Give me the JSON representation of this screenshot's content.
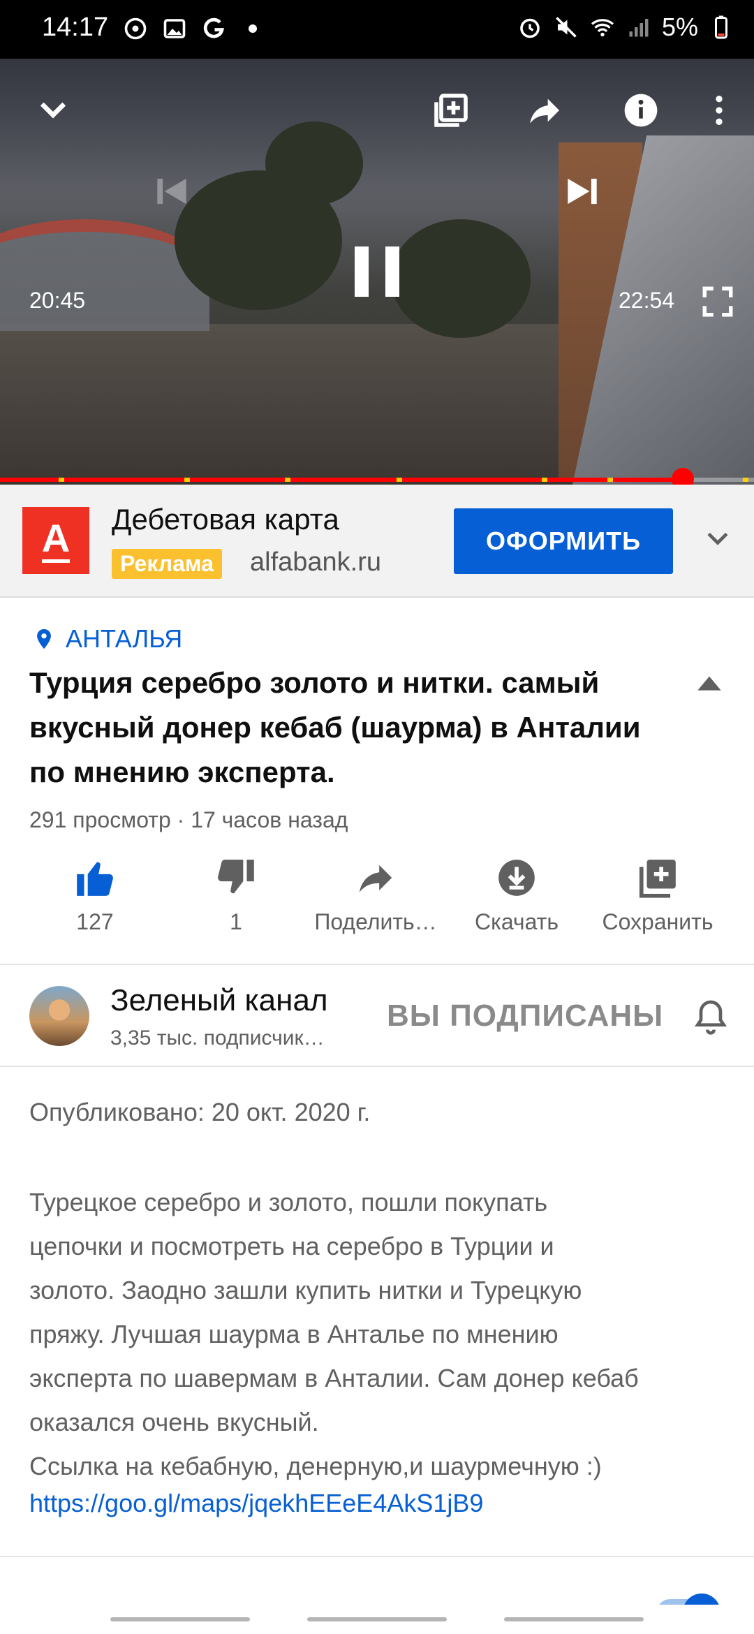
{
  "status_bar": {
    "time": "14:17",
    "battery": "5%",
    "left_icons": [
      "sync-icon",
      "gallery-icon",
      "g-icon",
      "dot-icon"
    ],
    "right_icons": [
      "alarm-icon",
      "mute-icon",
      "wifi-icon",
      "signal-icon",
      "battery-icon"
    ]
  },
  "player": {
    "current_time": "20:45",
    "duration": "22:54",
    "progress_percent": 90.6,
    "colors": {
      "progress": "#ff0000",
      "ad_marker": "#ffd000"
    }
  },
  "ad": {
    "logo_letter": "А",
    "title": "Дебетовая карта",
    "badge": "Реклама",
    "domain": "alfabank.ru",
    "cta": "ОФОРМИТЬ",
    "colors": {
      "logo_bg": "#ef3124",
      "cta_bg": "#065fd4",
      "badge_bg": "#fbc02d"
    }
  },
  "video": {
    "location": "АНТАЛЬЯ",
    "title": "Турция серебро золото и нитки. самый вкусный донер кебаб (шаурма) в Анталии по мнению  эксперта.",
    "meta": "291 просмотр · 17 часов назад"
  },
  "actions": [
    {
      "name": "like",
      "label": "127",
      "icon": "thumbs-up-icon",
      "active": true
    },
    {
      "name": "dislike",
      "label": "1",
      "icon": "thumbs-down-icon",
      "active": false
    },
    {
      "name": "share",
      "label": "Поделить…",
      "icon": "share-icon",
      "active": false
    },
    {
      "name": "download",
      "label": "Скачать",
      "icon": "download-icon",
      "active": false
    },
    {
      "name": "save",
      "label": "Сохранить",
      "icon": "playlist-add-icon",
      "active": false
    }
  ],
  "channel": {
    "name": "Зеленый канал",
    "subscribers": "3,35 тыс. подписчик…",
    "subscribed_label": "ВЫ ПОДПИСАНЫ"
  },
  "description": {
    "published": "Опубликовано: 20 окт. 2020 г.",
    "lines": [
      "Турецкое серебро и золото, пошли покупать",
      "цепочки и посмотреть на серебро в Турции и",
      "золото. Заодно зашли купить нитки и Турецкую",
      "пряжу. Лучшая шаурма в Анталье по мнению",
      "эксперта по шавермам в Анталии. Сам донер кебаб",
      "оказался очень вкусный.",
      "Ссылка на кебабную, денерную,и шаурмечную :)"
    ],
    "link": "https://goo.gl/maps/jqekhEEeE4AkS1jB9"
  }
}
